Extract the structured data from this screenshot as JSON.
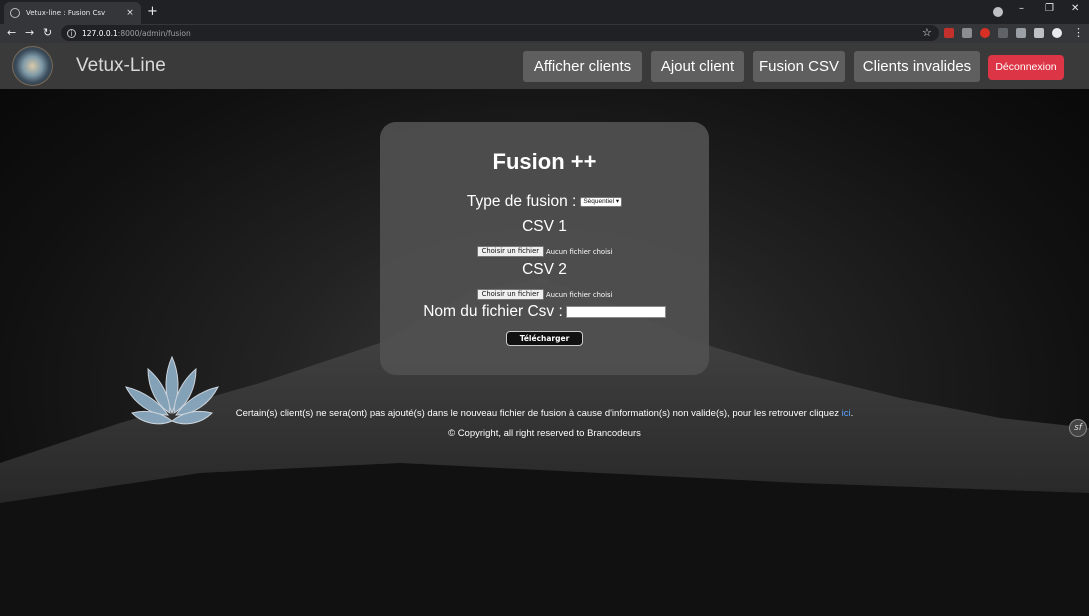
{
  "browser": {
    "tab_title": "Vetux-line : Fusion Csv",
    "tab_close": "×",
    "new_tab": "+",
    "url_host": "127.0.0.1",
    "url_path": ":8000/admin/fusion",
    "window_controls": {
      "minimize": "–",
      "restore": "❐",
      "close": "✕"
    },
    "nav": {
      "back": "←",
      "forward": "→",
      "reload": "↻",
      "star": "☆",
      "menu": "⋮"
    }
  },
  "site": {
    "brand": "Vetux-Line",
    "nav": [
      {
        "label": "Afficher clients"
      },
      {
        "label": "Ajout client"
      },
      {
        "label": "Fusion CSV"
      },
      {
        "label": "Clients invalides"
      }
    ],
    "logout_label": "Déconnexion"
  },
  "form": {
    "title": "Fusion ++",
    "type_label": "Type de fusion :",
    "type_selected": "Séquentiel",
    "csv1_label": "CSV 1",
    "csv2_label": "CSV 2",
    "file_button": "Choisir un fichier",
    "file_status": "Aucun fichier choisi",
    "filename_label": "Nom du fichier Csv :",
    "filename_value": "",
    "submit_label": "Télécharger"
  },
  "notice": {
    "text": "Certain(s) client(s) ne sera(ont) pas ajouté(s) dans le nouveau fichier de fusion à cause d'information(s) non valide(s), pour les retrouver cliquez ",
    "link": "ici",
    "suffix": "."
  },
  "footer": "© Copyright, all right reserved to Brancodeurs",
  "colors": {
    "logout": "#dc3545",
    "navlink": "#5f5f5f",
    "card": "#505050",
    "link": "#5ba4ff"
  }
}
